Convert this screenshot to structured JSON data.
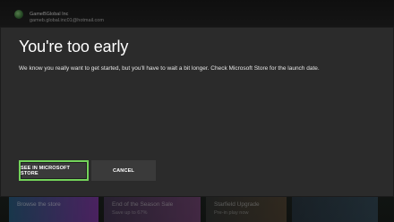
{
  "profile": {
    "name": "GameBGlobal Inc",
    "email": "gameb.global.inc01@hotmail.com"
  },
  "dialog": {
    "title": "You're too early",
    "message": "We know you really want to get started, but you'll have to wait a bit longer. Check Microsoft Store for the launch date.",
    "buttons": {
      "primary": "SEE IN MICROSOFT STORE",
      "secondary": "CANCEL"
    }
  },
  "background_tiles": [
    {
      "title": "Browse the store",
      "subtitle": ""
    },
    {
      "title": "End of the Season Sale",
      "subtitle": "Save up to 67%"
    },
    {
      "title": "Starfield Upgrade",
      "subtitle": "Pre-in play now"
    },
    {
      "title": "",
      "subtitle": ""
    }
  ],
  "colors": {
    "focus_outline": "#73d35a",
    "dialog_bg": "#2b2b2b",
    "button_bg": "#3a3a3a"
  }
}
